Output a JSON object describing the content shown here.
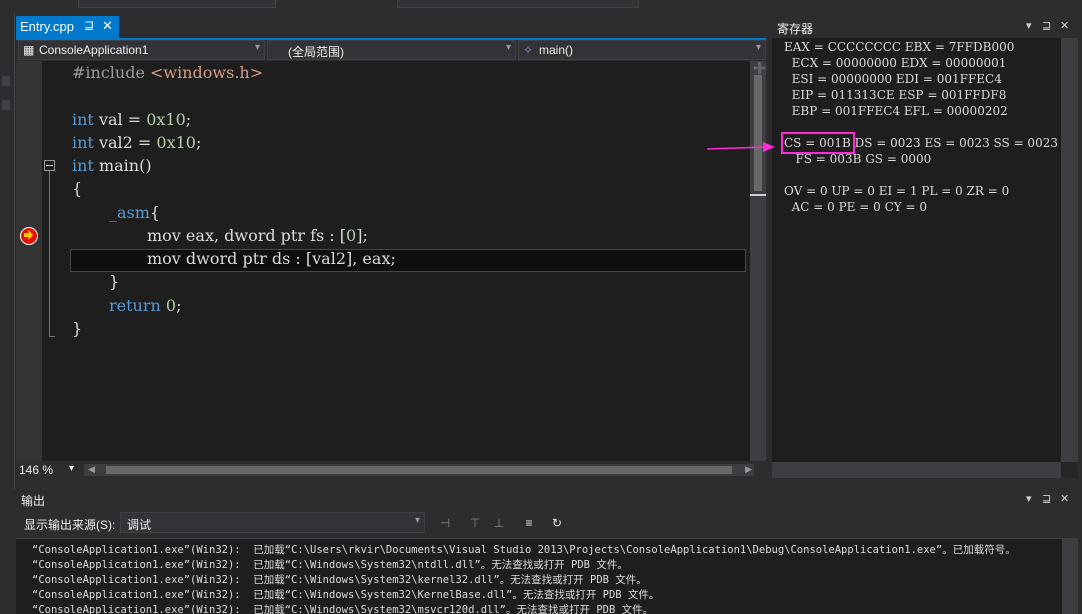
{
  "editor": {
    "tab_title": "Entry.cpp",
    "tab_pin": "⊒",
    "tab_close": "✕",
    "nav_project": "ConsoleApplication1",
    "nav_scope": "(全局范围)",
    "nav_function": "main()",
    "zoom": "146 %",
    "code": {
      "l1a": "#include ",
      "l1b": "<windows.h>",
      "l2kw": "int",
      "l2a": " val = ",
      "l2n": "0x10",
      "l2b": ";",
      "l3kw": "int",
      "l3a": " val2 = ",
      "l3n": "0x10",
      "l3b": ";",
      "l4kw": "int",
      "l4a": " main()",
      "l5": "{",
      "l6kw": "_asm",
      "l6a": "{",
      "l7a": "mov eax, dword ptr fs : [",
      "l7n": "0",
      "l7b": "];",
      "l8": "mov dword ptr ds : [val2], eax;",
      "l9": "}",
      "l10kw": "return",
      "l10a": " ",
      "l10n": "0",
      "l10b": ";",
      "l11": "}"
    }
  },
  "registers": {
    "title": "寄存器",
    "lines": [
      "EAX = CCCCCCCC EBX = 7FFDB000",
      "  ECX = 00000000 EDX = 00000001",
      "  ESI = 00000000 EDI = 001FFEC4",
      "  EIP = 011313CE ESP = 001FFDF8",
      "  EBP = 001FFEC4 EFL = 00000202",
      "",
      "CS = 001B DS = 0023 ES = 0023 SS = 0023",
      "   FS = 003B GS = 0000",
      "",
      "OV = 0 UP = 0 EI = 1 PL = 0 ZR = 0",
      "  AC = 0 PE = 0 CY = 0"
    ],
    "highlight_color": "#ff2bd6"
  },
  "output": {
    "title": "输出",
    "source_label": "显示输出来源(S):",
    "source_value": "调试",
    "lines": [
      "“ConsoleApplication1.exe”(Win32):  已加载“C:\\Users\\rkvir\\Documents\\Visual Studio 2013\\Projects\\ConsoleApplication1\\Debug\\ConsoleApplication1.exe”。已加载符号。",
      "“ConsoleApplication1.exe”(Win32):  已加载“C:\\Windows\\System32\\ntdll.dll”。无法查找或打开 PDB 文件。",
      "“ConsoleApplication1.exe”(Win32):  已加载“C:\\Windows\\System32\\kernel32.dll”。无法查找或打开 PDB 文件。",
      "“ConsoleApplication1.exe”(Win32):  已加载“C:\\Windows\\System32\\KernelBase.dll”。无法查找或打开 PDB 文件。",
      "“ConsoleApplication1.exe”(Win32):  已加载“C:\\Windows\\System32\\msvcr120d.dll”。无法查找或打开 PDB 文件。"
    ]
  },
  "panel_icons": {
    "dropdown": "▾",
    "pin": "⊒",
    "close": "✕"
  },
  "colors": {
    "accent": "#007acc",
    "annotation": "#ff2bd6"
  }
}
